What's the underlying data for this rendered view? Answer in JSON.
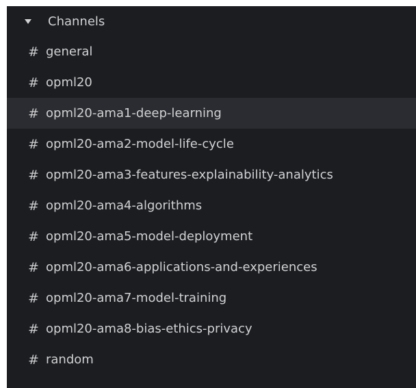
{
  "sidebar": {
    "section_title": "Channels",
    "caret_icon": "caret-down-icon",
    "hash_symbol": "#",
    "colors": {
      "background": "#1b1d21",
      "hover": "#2b2c31",
      "text": "#d1d2d3"
    },
    "channels": [
      {
        "name": "general"
      },
      {
        "name": "opml20"
      },
      {
        "name": "opml20-ama1-deep-learning",
        "hovered": true
      },
      {
        "name": "opml20-ama2-model-life-cycle"
      },
      {
        "name": "opml20-ama3-features-explainability-analytics"
      },
      {
        "name": "opml20-ama4-algorithms"
      },
      {
        "name": "opml20-ama5-model-deployment"
      },
      {
        "name": "opml20-ama6-applications-and-experiences"
      },
      {
        "name": "opml20-ama7-model-training"
      },
      {
        "name": "opml20-ama8-bias-ethics-privacy"
      },
      {
        "name": "random"
      }
    ]
  }
}
